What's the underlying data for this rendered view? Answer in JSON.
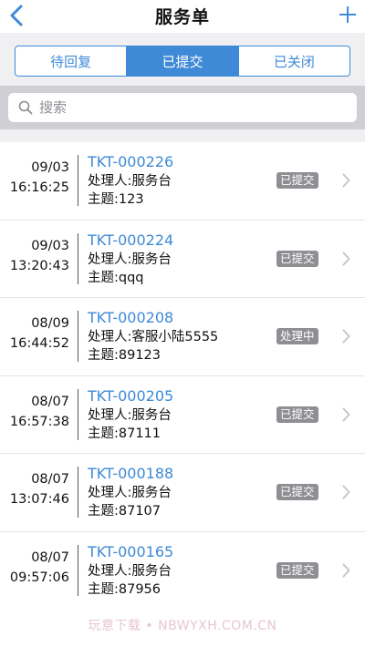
{
  "navbar": {
    "title": "服务单",
    "back_icon": "chevron-left-icon",
    "add_icon": "plus-icon",
    "accent": "#3e8ad6"
  },
  "tabs": [
    {
      "label": "待回复",
      "active": false
    },
    {
      "label": "已提交",
      "active": true
    },
    {
      "label": "已关闭",
      "active": false
    }
  ],
  "search": {
    "placeholder": "搜索",
    "value": ""
  },
  "tickets": [
    {
      "date": "09/03",
      "time": "16:16:25",
      "id": "TKT-000226",
      "handler": "处理人:服务台",
      "subject": "主题:123",
      "status": "已提交"
    },
    {
      "date": "09/03",
      "time": "13:20:43",
      "id": "TKT-000224",
      "handler": "处理人:服务台",
      "subject": "主题:qqq",
      "status": "已提交"
    },
    {
      "date": "08/09",
      "time": "16:44:52",
      "id": "TKT-000208",
      "handler": "处理人:客服小陆5555",
      "subject": "主题:89123",
      "status": "处理中"
    },
    {
      "date": "08/07",
      "time": "16:57:38",
      "id": "TKT-000205",
      "handler": "处理人:服务台",
      "subject": "主题:87111",
      "status": "已提交"
    },
    {
      "date": "08/07",
      "time": "13:07:46",
      "id": "TKT-000188",
      "handler": "处理人:服务台",
      "subject": "主题:87107",
      "status": "已提交"
    },
    {
      "date": "08/07",
      "time": "09:57:06",
      "id": "TKT-000165",
      "handler": "处理人:服务台",
      "subject": "主题:87956",
      "status": "已提交"
    }
  ],
  "watermark": "玩意下载 • NBWYXH.COM.CN"
}
